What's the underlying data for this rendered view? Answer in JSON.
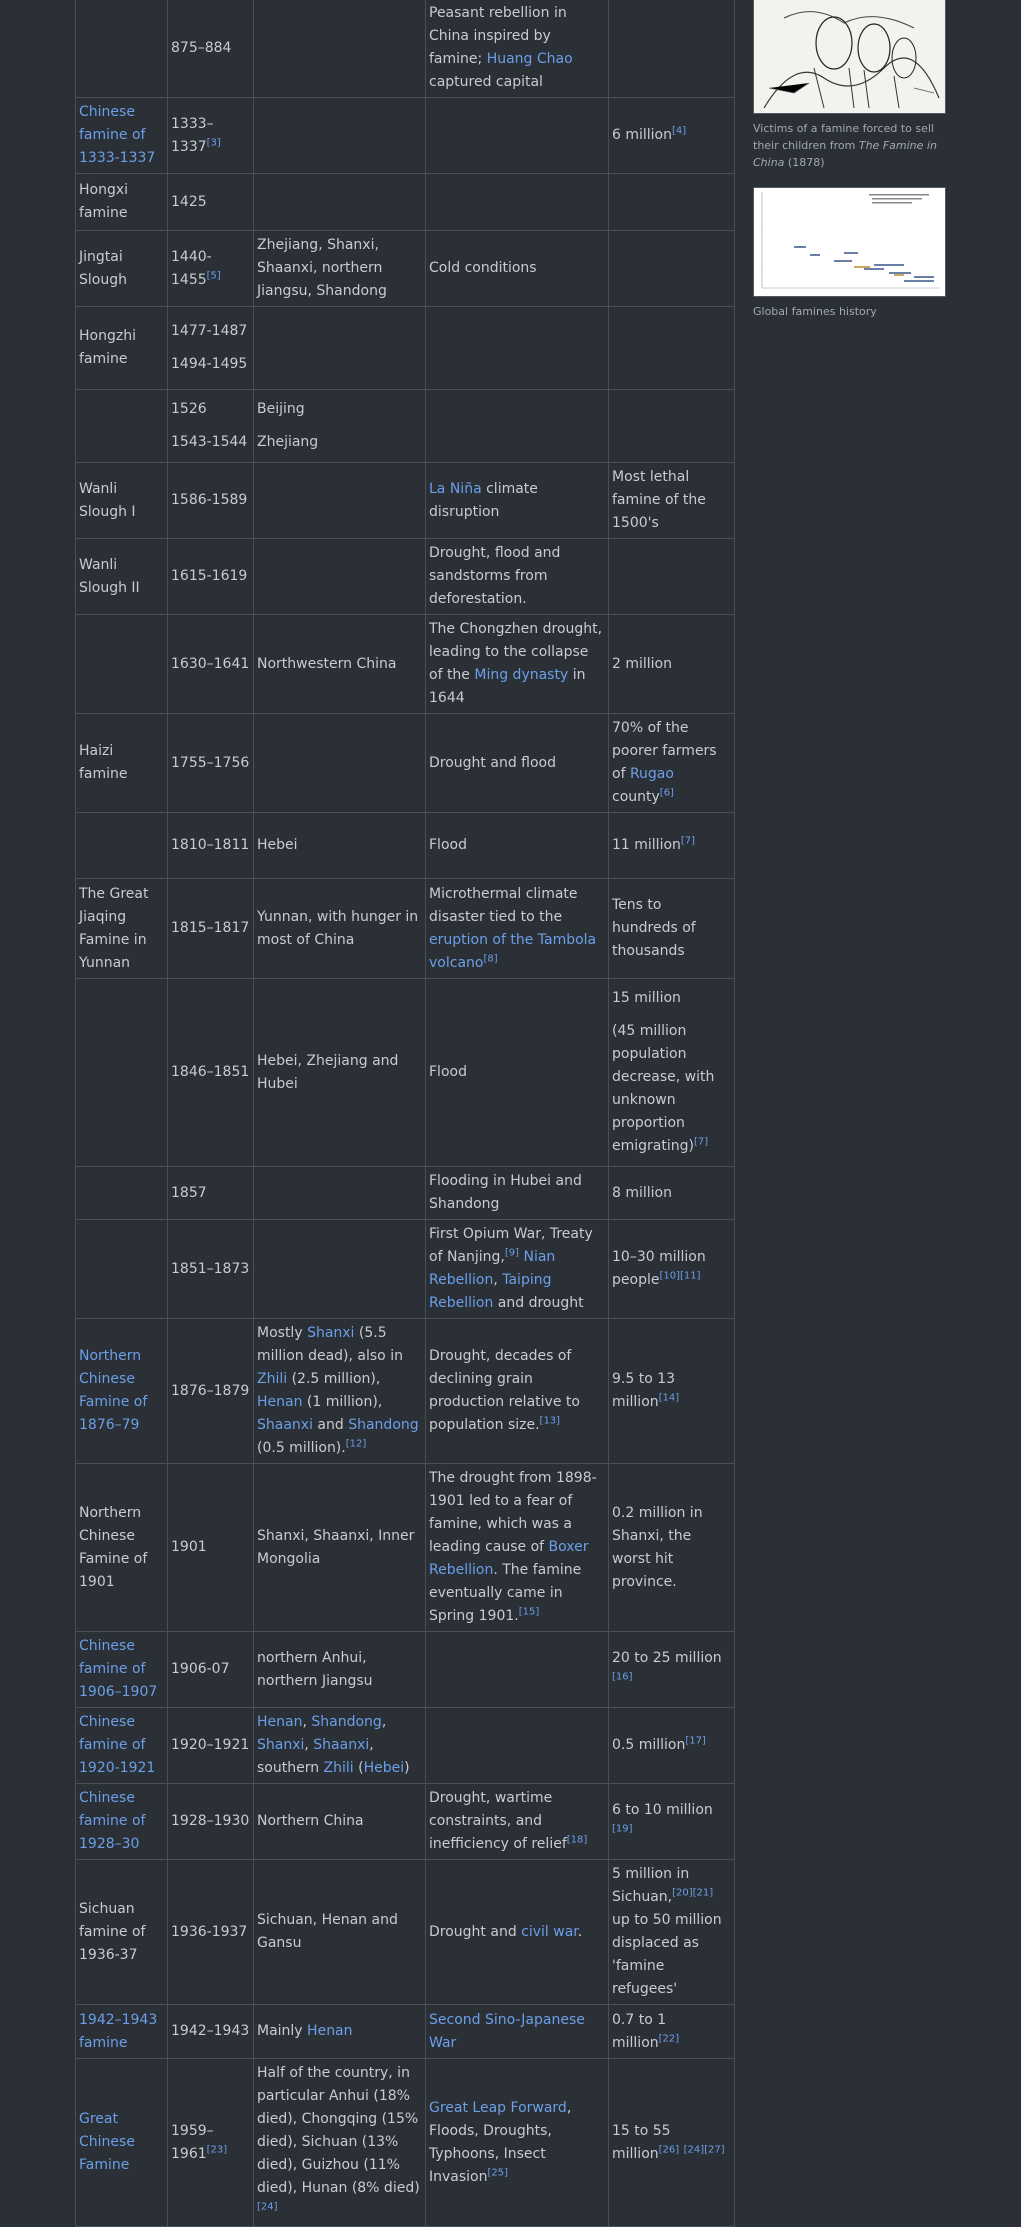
{
  "rows": [
    {
      "name": [],
      "years": [
        "875–884"
      ],
      "region": [],
      "cause": [
        {
          "t": "Peasant rebellion in China inspired by famine; "
        },
        {
          "t": "Huang Chao",
          "link": true
        },
        {
          "t": " captured capital"
        }
      ],
      "deaths": []
    },
    {
      "name": [
        {
          "t": "Chinese famine of 1333-1337",
          "link": true
        }
      ],
      "years": [
        "1333–1337"
      ],
      "years_sup": "[3]",
      "region": [],
      "cause": [],
      "deaths": [
        {
          "t": "6 million"
        },
        {
          "t": "[4]",
          "sup": true
        }
      ]
    },
    {
      "name": [
        {
          "t": "Hongxi famine"
        }
      ],
      "years": [
        "1425"
      ],
      "region": [],
      "cause": [],
      "deaths": []
    },
    {
      "name": [
        {
          "t": "Jingtai Slough"
        }
      ],
      "years": [
        "1440-1455"
      ],
      "years_sup": "[5]",
      "region": [
        {
          "t": "Zhejiang, Shanxi, Shaanxi, northern Jiangsu, Shandong"
        }
      ],
      "cause": [
        {
          "t": "Cold conditions"
        }
      ],
      "deaths": []
    },
    {
      "name": [
        {
          "t": "Hongzhi famine"
        }
      ],
      "years": [
        "1477-1487",
        "1494-1495"
      ],
      "region": [],
      "cause": [],
      "deaths": []
    },
    {
      "name": [],
      "years": [
        "1526",
        "1543-1544"
      ],
      "region": [
        {
          "t": "Beijing"
        }
      ],
      "region2": "Zhejiang",
      "cause": [],
      "deaths": []
    },
    {
      "name": [
        {
          "t": "Wanli Slough I"
        }
      ],
      "years": [
        "1586-1589"
      ],
      "region": [],
      "cause": [
        {
          "t": "La Niña",
          "link": true
        },
        {
          "t": " climate disruption"
        }
      ],
      "deaths": [
        {
          "t": "Most lethal famine of the 1500's"
        }
      ]
    },
    {
      "name": [
        {
          "t": "Wanli Slough II"
        }
      ],
      "years": [
        "1615-1619"
      ],
      "region": [],
      "cause": [
        {
          "t": "Drought, flood and sandstorms from deforestation."
        }
      ],
      "deaths": []
    },
    {
      "name": [],
      "years": [
        "1630–1641"
      ],
      "region": [
        {
          "t": "Northwestern China"
        }
      ],
      "cause": [
        {
          "t": "The Chongzhen drought, leading to the collapse of the "
        },
        {
          "t": "Ming dynasty",
          "link": true
        },
        {
          "t": " in 1644"
        }
      ],
      "deaths": [
        {
          "t": "2 million"
        }
      ]
    },
    {
      "name": [
        {
          "t": "Haizi famine"
        }
      ],
      "years": [
        "1755–1756"
      ],
      "region": [],
      "cause": [
        {
          "t": "Drought and flood"
        }
      ],
      "deaths": [
        {
          "t": "70% of the poorer farmers of "
        },
        {
          "t": "Rugao",
          "link": true
        },
        {
          "t": " county"
        },
        {
          "t": "[6]",
          "sup": true
        }
      ]
    },
    {
      "name": [],
      "years": [
        "1810–1811"
      ],
      "region": [
        {
          "t": "Hebei"
        }
      ],
      "cause": [
        {
          "t": "Flood"
        }
      ],
      "deaths": [
        {
          "t": "11 million"
        },
        {
          "t": "[7]",
          "sup": true
        }
      ]
    },
    {
      "name": [
        {
          "t": "The Great Jiaqing Famine in Yunnan"
        }
      ],
      "years": [
        "1815–1817"
      ],
      "region": [
        {
          "t": "Yunnan, with hunger in most of China"
        }
      ],
      "cause": [
        {
          "t": "Microthermal climate disaster tied to the "
        },
        {
          "t": "eruption of the Tambola volcano",
          "link": true
        },
        {
          "t": "[8]",
          "sup": true
        }
      ],
      "deaths": [
        {
          "t": "Tens to hundreds of thousands"
        }
      ]
    },
    {
      "name": [],
      "years": [
        "1846–1851"
      ],
      "region": [
        {
          "t": "Hebei, Zhejiang and Hubei"
        }
      ],
      "cause": [
        {
          "t": "Flood"
        }
      ],
      "deaths": [
        {
          "t": "15 million"
        }
      ],
      "deaths2": [
        {
          "t": "(45 million population decrease, with unknown proportion emigrating)"
        },
        {
          "t": "[7]",
          "sup": true
        }
      ]
    },
    {
      "name": [],
      "years": [
        "1857"
      ],
      "region": [],
      "cause": [
        {
          "t": "Flooding in Hubei and Shandong"
        }
      ],
      "deaths": [
        {
          "t": "8 million"
        }
      ]
    },
    {
      "name": [],
      "years": [
        "1851–1873"
      ],
      "region": [],
      "cause": [
        {
          "t": "First Opium War, Treaty of Nanjing,"
        },
        {
          "t": "[9]",
          "sup": true
        },
        {
          "t": " "
        },
        {
          "t": "Nian Rebellion",
          "link": true
        },
        {
          "t": ", "
        },
        {
          "t": "Taiping Rebellion",
          "link": true
        },
        {
          "t": " and drought"
        }
      ],
      "deaths": [
        {
          "t": "10–30 million people"
        },
        {
          "t": "[10][11]",
          "sup": true
        }
      ]
    },
    {
      "name": [
        {
          "t": "Northern Chinese Famine of 1876–79",
          "link": true
        }
      ],
      "years": [
        "1876–1879"
      ],
      "region": [
        {
          "t": "Mostly "
        },
        {
          "t": "Shanxi",
          "link": true
        },
        {
          "t": " (5.5 million dead), also in "
        },
        {
          "t": "Zhili",
          "link": true
        },
        {
          "t": " (2.5 million), "
        },
        {
          "t": "Henan",
          "link": true
        },
        {
          "t": " (1 million), "
        },
        {
          "t": "Shaanxi",
          "link": true
        },
        {
          "t": " and "
        },
        {
          "t": "Shandong",
          "link": true
        },
        {
          "t": " (0.5 million)."
        },
        {
          "t": "[12]",
          "sup": true
        }
      ],
      "cause": [
        {
          "t": "Drought, decades of declining grain production relative to population size."
        },
        {
          "t": "[13]",
          "sup": true
        }
      ],
      "deaths": [
        {
          "t": "9.5 to 13 million"
        },
        {
          "t": "[14]",
          "sup": true
        }
      ]
    },
    {
      "name": [
        {
          "t": "Northern Chinese Famine of 1901"
        }
      ],
      "years": [
        "1901"
      ],
      "region": [
        {
          "t": "Shanxi, Shaanxi, Inner Mongolia"
        }
      ],
      "cause": [
        {
          "t": "The drought from 1898-1901 led to a fear of famine, which was a leading cause of "
        },
        {
          "t": "Boxer Rebellion",
          "link": true
        },
        {
          "t": ". The famine eventually came in Spring 1901."
        },
        {
          "t": "[15]",
          "sup": true
        }
      ],
      "deaths": [
        {
          "t": "0.2 million in Shanxi, the worst hit province."
        }
      ]
    },
    {
      "name": [
        {
          "t": "Chinese famine of 1906–1907",
          "link": true
        }
      ],
      "years": [
        "1906-07"
      ],
      "region": [
        {
          "t": "northern Anhui, northern Jiangsu"
        }
      ],
      "cause": [],
      "deaths": [
        {
          "t": "20 to 25 million "
        },
        {
          "t": "[16]",
          "sup": true
        }
      ]
    },
    {
      "name": [
        {
          "t": "Chinese famine of 1920-1921",
          "link": true
        }
      ],
      "years": [
        "1920–1921"
      ],
      "region": [
        {
          "t": "Henan",
          "link": true
        },
        {
          "t": ", "
        },
        {
          "t": "Shandong",
          "link": true
        },
        {
          "t": ", "
        },
        {
          "t": "Shanxi",
          "link": true
        },
        {
          "t": ", "
        },
        {
          "t": "Shaanxi",
          "link": true
        },
        {
          "t": ", southern "
        },
        {
          "t": "Zhili",
          "link": true
        },
        {
          "t": " ("
        },
        {
          "t": "Hebei",
          "link": true
        },
        {
          "t": ")"
        }
      ],
      "cause": [],
      "deaths": [
        {
          "t": "0.5 million"
        },
        {
          "t": "[17]",
          "sup": true
        }
      ]
    },
    {
      "name": [
        {
          "t": "Chinese famine of 1928–30",
          "link": true
        }
      ],
      "years": [
        "1928–1930"
      ],
      "region": [
        {
          "t": "Northern China"
        }
      ],
      "cause": [
        {
          "t": "Drought, wartime constraints, and inefficiency of relief"
        },
        {
          "t": "[18]",
          "sup": true
        }
      ],
      "deaths": [
        {
          "t": "6 to 10 million "
        },
        {
          "t": "[19]",
          "sup": true
        }
      ]
    },
    {
      "name": [
        {
          "t": "Sichuan famine of 1936-37"
        }
      ],
      "years": [
        "1936-1937"
      ],
      "region": [
        {
          "t": "Sichuan, Henan and Gansu"
        }
      ],
      "cause": [
        {
          "t": "Drought and "
        },
        {
          "t": "civil war",
          "link": true
        },
        {
          "t": "."
        }
      ],
      "deaths": [
        {
          "t": "5 million in Sichuan,"
        },
        {
          "t": "[20][21]",
          "sup": true
        },
        {
          "t": " up to 50 million displaced as 'famine refugees'"
        }
      ]
    },
    {
      "name": [
        {
          "t": "1942–1943 famine",
          "link": true
        }
      ],
      "years": [
        "1942–1943"
      ],
      "region": [
        {
          "t": "Mainly "
        },
        {
          "t": "Henan",
          "link": true
        }
      ],
      "cause": [
        {
          "t": "Second Sino-Japanese War",
          "link": true
        }
      ],
      "deaths": [
        {
          "t": "0.7 to 1 million"
        },
        {
          "t": "[22]",
          "sup": true
        }
      ]
    },
    {
      "name": [
        {
          "t": "Great Chinese Famine",
          "link": true
        }
      ],
      "years": [
        "1959–1961"
      ],
      "years_sup": "[23]",
      "region": [
        {
          "t": "Half of the country, in particular Anhui (18% died), Chongqing (15% died), Sichuan (13% died), Guizhou (11% died), Hunan (8% died)"
        },
        {
          "t": "[24]",
          "sup": true
        }
      ],
      "cause": [
        {
          "t": "Great Leap Forward",
          "link": true
        },
        {
          "t": ", Floods, Droughts, Typhoons, Insect Invasion"
        },
        {
          "t": "[25]",
          "sup": true
        }
      ],
      "deaths": [
        {
          "t": "15 to 55 million"
        },
        {
          "t": "[26]",
          "sup": true
        },
        {
          "t": " "
        },
        {
          "t": "[24][27]",
          "sup": true
        }
      ]
    }
  ],
  "sidebar": {
    "caption1_pre": "Victims of a famine forced to sell their children from ",
    "caption1_em": "The Famine in China",
    "caption1_post": " (1878)",
    "caption2": "Global famines history"
  }
}
